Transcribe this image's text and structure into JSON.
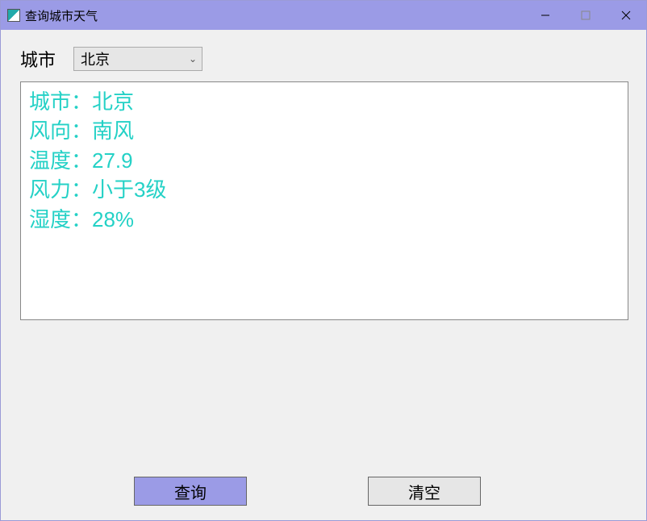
{
  "window": {
    "title": "查询城市天气"
  },
  "form": {
    "city_label": "城市",
    "city_selected": "北京"
  },
  "result": {
    "lines": [
      "城市：北京",
      "风向：南风",
      "温度：27.9",
      "风力：小于3级",
      "湿度：28%"
    ]
  },
  "buttons": {
    "query": "查询",
    "clear": "清空"
  }
}
